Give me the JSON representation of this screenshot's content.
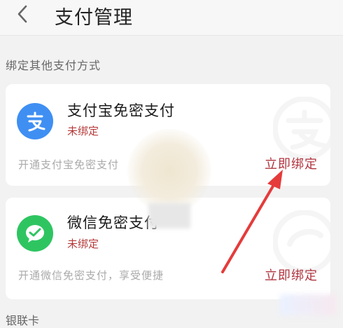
{
  "header": {
    "title": "支付管理"
  },
  "section": {
    "label": "绑定其他支付方式"
  },
  "cards": [
    {
      "name": "支付宝免密支付",
      "status": "未绑定",
      "desc": "开通支付宝免密支付",
      "action": "立即绑定",
      "icon": "alipay-icon"
    },
    {
      "name": "微信免密支付",
      "status": "未绑定",
      "desc": "开通微信免密支付，享受便捷",
      "action": "立即绑定",
      "icon": "wechat-pay-icon"
    }
  ],
  "footer_section": {
    "label": "银联卡"
  },
  "colors": {
    "accent": "#b0343f",
    "alipay": "#3f8ff3",
    "wechat": "#2ec561",
    "annotation_arrow": "#e53b3b"
  }
}
